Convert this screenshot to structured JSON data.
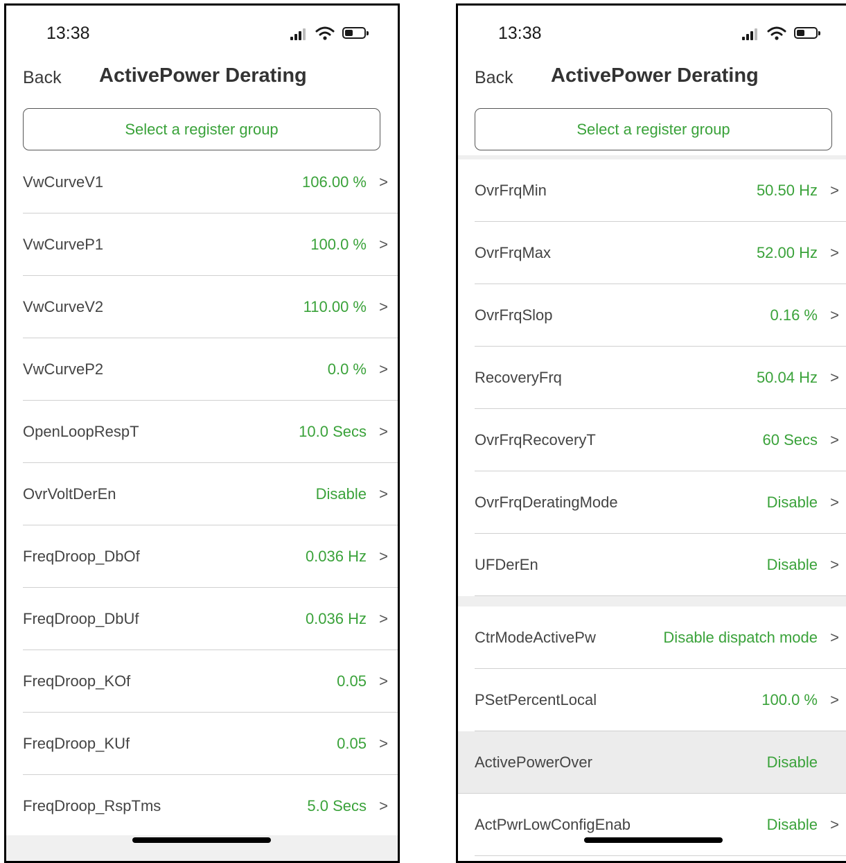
{
  "screens": [
    {
      "status_time": "13:38",
      "back_label": "Back",
      "title": "ActivePower Derating",
      "register_button": "Select a register group",
      "rows": [
        {
          "label": "VwCurveV1",
          "value": "106.00 %"
        },
        {
          "label": "VwCurveP1",
          "value": "100.0 %"
        },
        {
          "label": "VwCurveV2",
          "value": "110.00 %"
        },
        {
          "label": "VwCurveP2",
          "value": "0.0 %"
        },
        {
          "label": "OpenLoopRespT",
          "value": "10.0 Secs"
        },
        {
          "label": "OvrVoltDerEn",
          "value": "Disable"
        },
        {
          "label": "FreqDroop_DbOf",
          "value": "0.036 Hz"
        },
        {
          "label": "FreqDroop_DbUf",
          "value": "0.036 Hz"
        },
        {
          "label": "FreqDroop_KOf",
          "value": "0.05"
        },
        {
          "label": "FreqDroop_KUf",
          "value": "0.05"
        },
        {
          "label": "FreqDroop_RspTms",
          "value": "5.0 Secs"
        }
      ]
    },
    {
      "status_time": "13:38",
      "back_label": "Back",
      "title": "ActivePower Derating",
      "register_button": "Select a register group",
      "rows_group1": [
        {
          "label": "OvrFrqMin",
          "value": "50.50 Hz"
        },
        {
          "label": "OvrFrqMax",
          "value": "52.00 Hz"
        },
        {
          "label": "OvrFrqSlop",
          "value": "0.16 %"
        },
        {
          "label": "RecoveryFrq",
          "value": "50.04 Hz"
        },
        {
          "label": "OvrFrqRecoveryT",
          "value": "60 Secs"
        },
        {
          "label": "OvrFrqDeratingMode",
          "value": "Disable"
        },
        {
          "label": "UFDerEn",
          "value": "Disable"
        }
      ],
      "rows_group2": [
        {
          "label": "CtrModeActivePw",
          "value": "Disable dispatch mode"
        },
        {
          "label": "PSetPercentLocal",
          "value": "100.0 %"
        },
        {
          "label": "ActivePowerOver",
          "value": "Disable"
        },
        {
          "label": "ActPwrLowConfigEnab",
          "value": "Disable"
        }
      ]
    }
  ],
  "icons": {
    "chevron": "chevron-right-icon",
    "signal": "cellular-signal-icon",
    "wifi": "wifi-icon",
    "battery": "battery-icon"
  },
  "colors": {
    "accent_green": "#3aa23a",
    "text": "#444444",
    "highlight_row": "#ececec"
  }
}
